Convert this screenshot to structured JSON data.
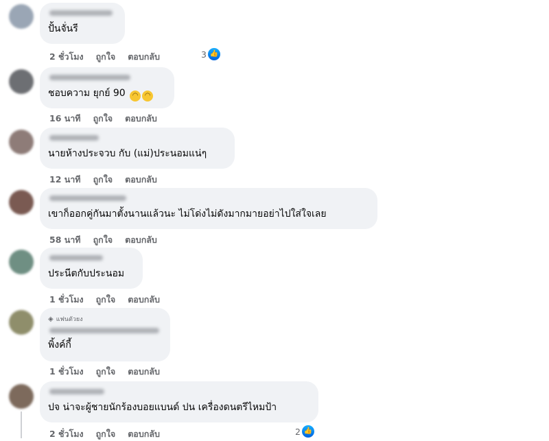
{
  "comments": [
    {
      "text": "ปั้นจั่นรี",
      "time": "2 ชั่วโมง",
      "like": "ถูกใจ",
      "reply": "ตอบกลับ",
      "reactions": "3",
      "avatar_color": "#9aa6b5"
    },
    {
      "text": "ชอบความ ยุกย์ 90",
      "emoji": [
        "😅",
        "😅"
      ],
      "time": "16 นาที",
      "like": "ถูกใจ",
      "reply": "ตอบกลับ",
      "avatar_color": "#6d6f73"
    },
    {
      "text": "นายห้างประจวบ กับ (แม่)ประนอมแน่ๆ",
      "time": "12 นาที",
      "like": "ถูกใจ",
      "reply": "ตอบกลับ",
      "avatar_color": "#8e7c78"
    },
    {
      "text": "เขาก็ออกคู่กันมาตั้งนานแล้วนะ ไม่โด่งไม่ดังมากมายอย่าไปใส่ใจเลย",
      "time": "58 นาที",
      "like": "ถูกใจ",
      "reply": "ตอบกลับ",
      "avatar_color": "#7a5a52"
    },
    {
      "text": "ประนีตกับประนอม",
      "time": "1 ชั่วโมง",
      "like": "ถูกใจ",
      "reply": "ตอบกลับ",
      "avatar_color": "#6f8f83"
    },
    {
      "badge": "แฟนตัวยง",
      "text": "พิ้งค์กี้",
      "time": "1 ชั่วโมง",
      "like": "ถูกใจ",
      "reply": "ตอบกลับ",
      "avatar_color": "#8f8e6b"
    },
    {
      "text": "ปจ น่าจะผู้ชายนักร้องบอยแบนด์ ปน เครื่องดนตรีไหมป้า",
      "time": "2 ชั่วโมง",
      "like": "ถูกใจ",
      "reply": "ตอบกลับ",
      "reactions": "2",
      "avatar_color": "#7d6a5c"
    }
  ],
  "icons": {
    "like": "thumbs-up-icon",
    "badge": "diamond-icon"
  }
}
